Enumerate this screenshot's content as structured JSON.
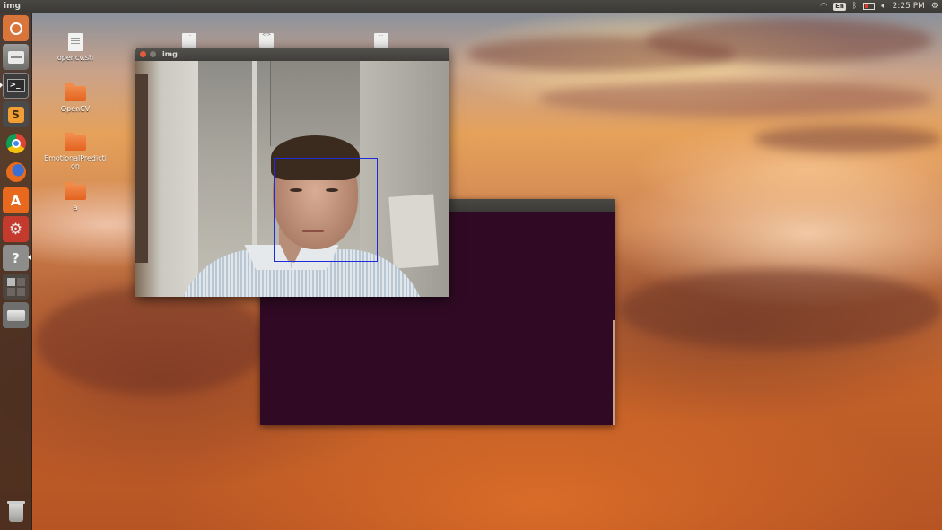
{
  "top_panel": {
    "app_title": "img",
    "tray": {
      "wifi_icon": "wifi-icon",
      "keyboard_layout": "En",
      "bluetooth_icon": "bluetooth-icon",
      "battery_icon": "battery-icon",
      "volume_icon": "volume-icon",
      "clock": "2:25 PM",
      "system_icon": "gear-icon"
    }
  },
  "launcher": {
    "items": [
      {
        "name": "dash",
        "icon": "ubuntu-logo-icon"
      },
      {
        "name": "files",
        "icon": "files-icon"
      },
      {
        "name": "terminal",
        "icon": "terminal-icon",
        "glyph": ">_"
      },
      {
        "name": "sublime-text",
        "icon": "sublime-text-icon",
        "glyph": "S"
      },
      {
        "name": "chrome",
        "icon": "chrome-icon"
      },
      {
        "name": "firefox",
        "icon": "firefox-icon"
      },
      {
        "name": "software-center",
        "icon": "software-center-icon",
        "glyph": "A"
      },
      {
        "name": "system-settings",
        "icon": "settings-icon",
        "glyph": "⚙"
      },
      {
        "name": "help",
        "icon": "help-icon",
        "glyph": "?"
      },
      {
        "name": "workspaces",
        "icon": "workspaces-icon"
      },
      {
        "name": "drive",
        "icon": "drive-icon"
      },
      {
        "name": "trash",
        "icon": "trash-icon"
      }
    ]
  },
  "desktop": {
    "icons": [
      {
        "label": "opencv.sh",
        "type": "file"
      },
      {
        "label": "OpenCV",
        "type": "folder"
      },
      {
        "label": "EmotionalPrediction",
        "type": "folder"
      },
      {
        "label": "a",
        "type": "folder"
      }
    ],
    "partial_icons": [
      {
        "label": "...",
        "type": "file"
      },
      {
        "label": "</>",
        "type": "file"
      },
      {
        "label": "...",
        "type": "file"
      }
    ]
  },
  "windows": {
    "img": {
      "title": "img",
      "close_icon": "close-icon",
      "minimize_icon": "minimize-icon",
      "face_box_color": "#1e2cd8"
    },
    "terminal": {
      "background": "#300a24"
    }
  }
}
